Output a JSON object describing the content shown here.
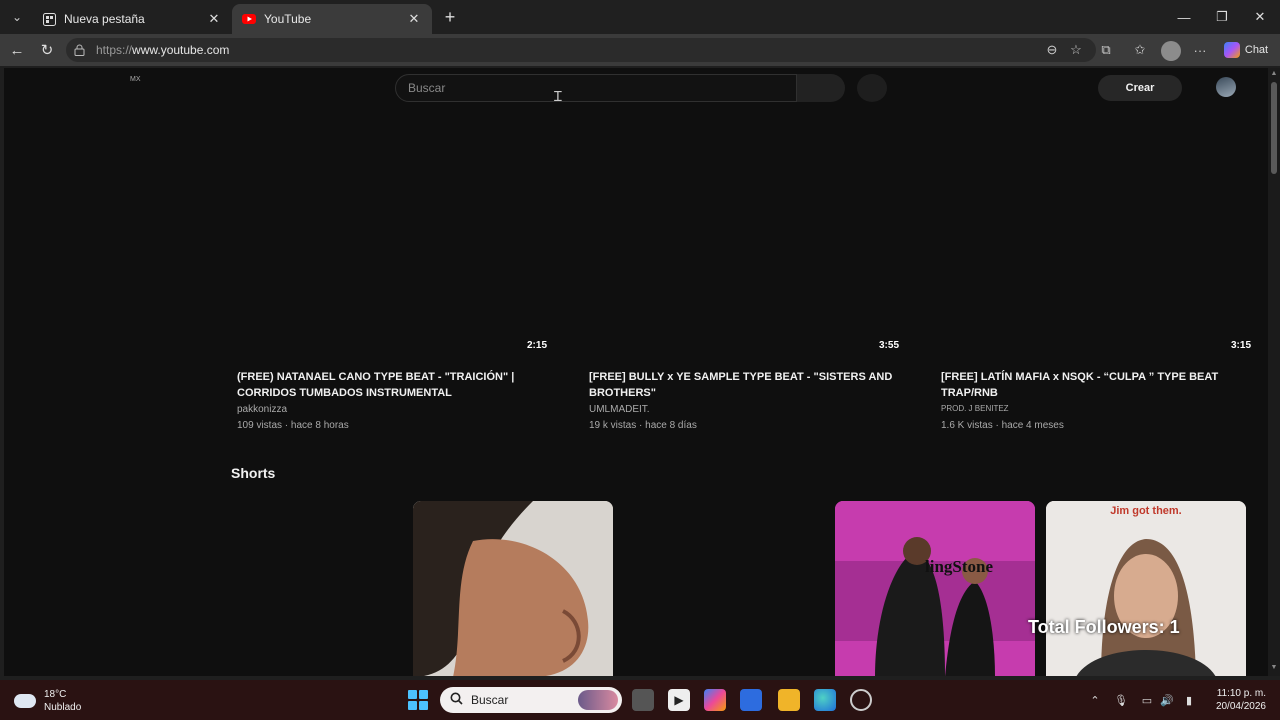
{
  "browser": {
    "tabs": [
      {
        "title": "Nueva pestaña",
        "active": false
      },
      {
        "title": "YouTube",
        "active": true
      }
    ],
    "url": {
      "scheme": "https://",
      "host": "www.youtube.com"
    },
    "chat_label": "Chat"
  },
  "youtube": {
    "region": "MX",
    "search_placeholder": "Buscar",
    "create_label": "Crear",
    "videos": [
      {
        "duration": "2:15",
        "title": "(FREE) NATANAEL CANO TYPE BEAT - \"TRAICIÓN\" | CORRIDOS TUMBADOS INSTRUMENTAL",
        "channel": "pakkonizza",
        "meta": "109 vistas · hace 8 horas"
      },
      {
        "duration": "3:55",
        "title": "[FREE] BULLY x YE SAMPLE TYPE BEAT - \"SISTERS AND BROTHERS\"",
        "channel": "UMLMADEIT.",
        "meta": "19 k vistas · hace 8 días"
      },
      {
        "duration": "3:15",
        "title": "[FREE] LATÍN MAFIA x NSQK - “CULPA ” TYPE BEAT TRAP/RNB",
        "channel": "PROD. J BENITEZ",
        "meta": "1.6 K vistas · hace 4 meses"
      }
    ],
    "shorts_heading": "Shorts",
    "shorts_overlays": {
      "top": "Jim got them.",
      "bottom": "Total Followers: 1",
      "sign": "lingStone"
    }
  },
  "taskbar": {
    "weather": {
      "temp": "18°C",
      "condition": "Nublado"
    },
    "search_label": "Buscar",
    "time": "11:10 p. m.",
    "date": "20/04/2026"
  },
  "colors": {
    "page_bg": "#0f0f0f",
    "youtube_red": "#ff0000",
    "taskbar_bg": "#2a1212"
  }
}
